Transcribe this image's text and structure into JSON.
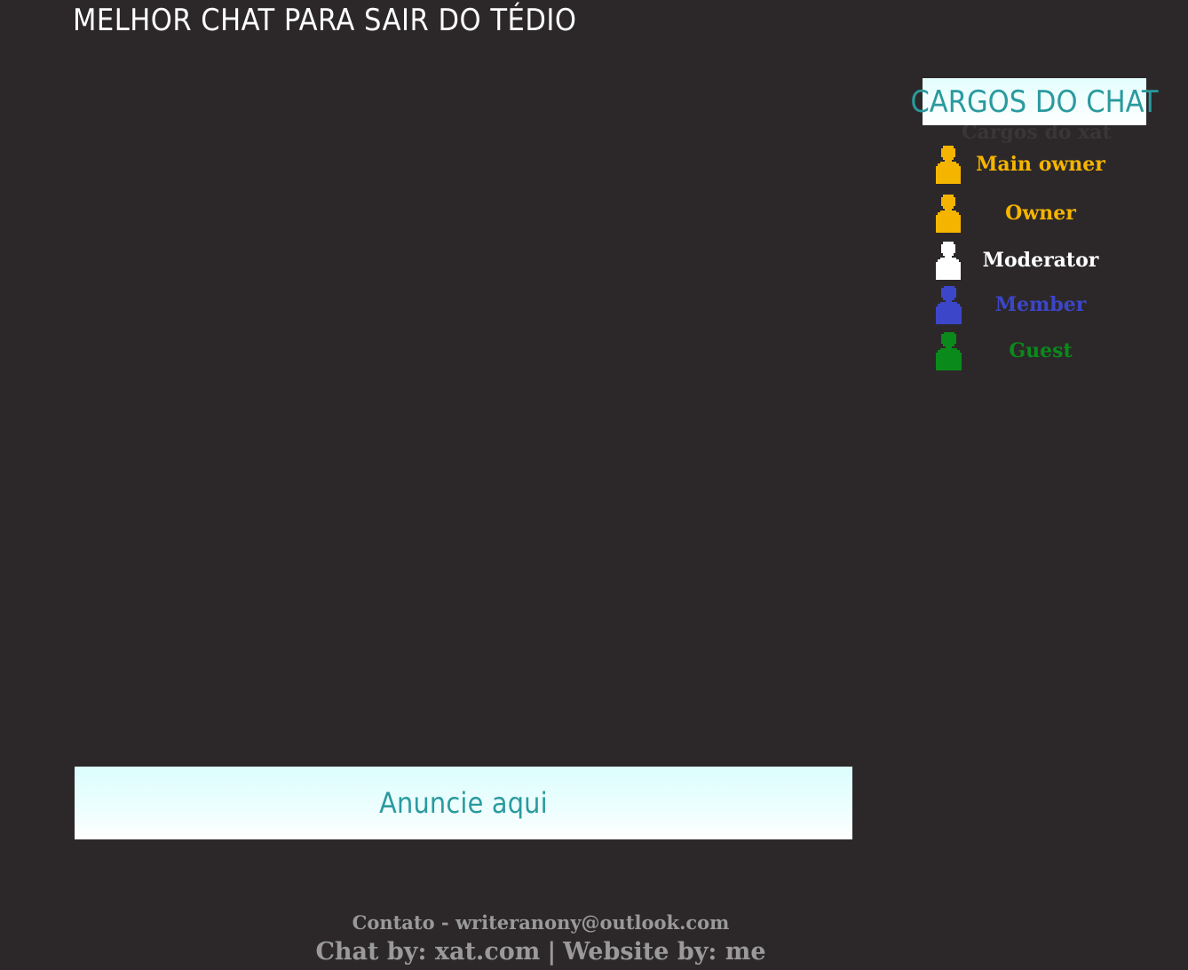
{
  "header": {
    "title": "MELHOR CHAT PARA SAIR DO TÉDIO"
  },
  "ad_banner": {
    "label": "Anuncie aqui"
  },
  "roles": {
    "title": "CARGOS DO CHAT",
    "ghost_text": "Cargos do xat",
    "items": [
      {
        "label": "Main owner",
        "color": "#f5b400",
        "icon": "person-icon"
      },
      {
        "label": "Owner",
        "color": "#f5b400",
        "icon": "person-icon"
      },
      {
        "label": "Moderator",
        "color": "#ffffff",
        "icon": "person-icon"
      },
      {
        "label": "Member",
        "color": "#3c46c8",
        "icon": "person-icon"
      },
      {
        "label": "Guest",
        "color": "#0a8a1a",
        "icon": "person-icon"
      }
    ]
  },
  "footer": {
    "contact": "Contato - writeranony@outlook.com",
    "chat_by": "Chat by: xat.com",
    "separator": "|",
    "website_by": "Website by: me"
  },
  "colors": {
    "background": "#2c282a",
    "accent_teal": "#2a9a9e",
    "footer_text": "#9a9a9a"
  }
}
